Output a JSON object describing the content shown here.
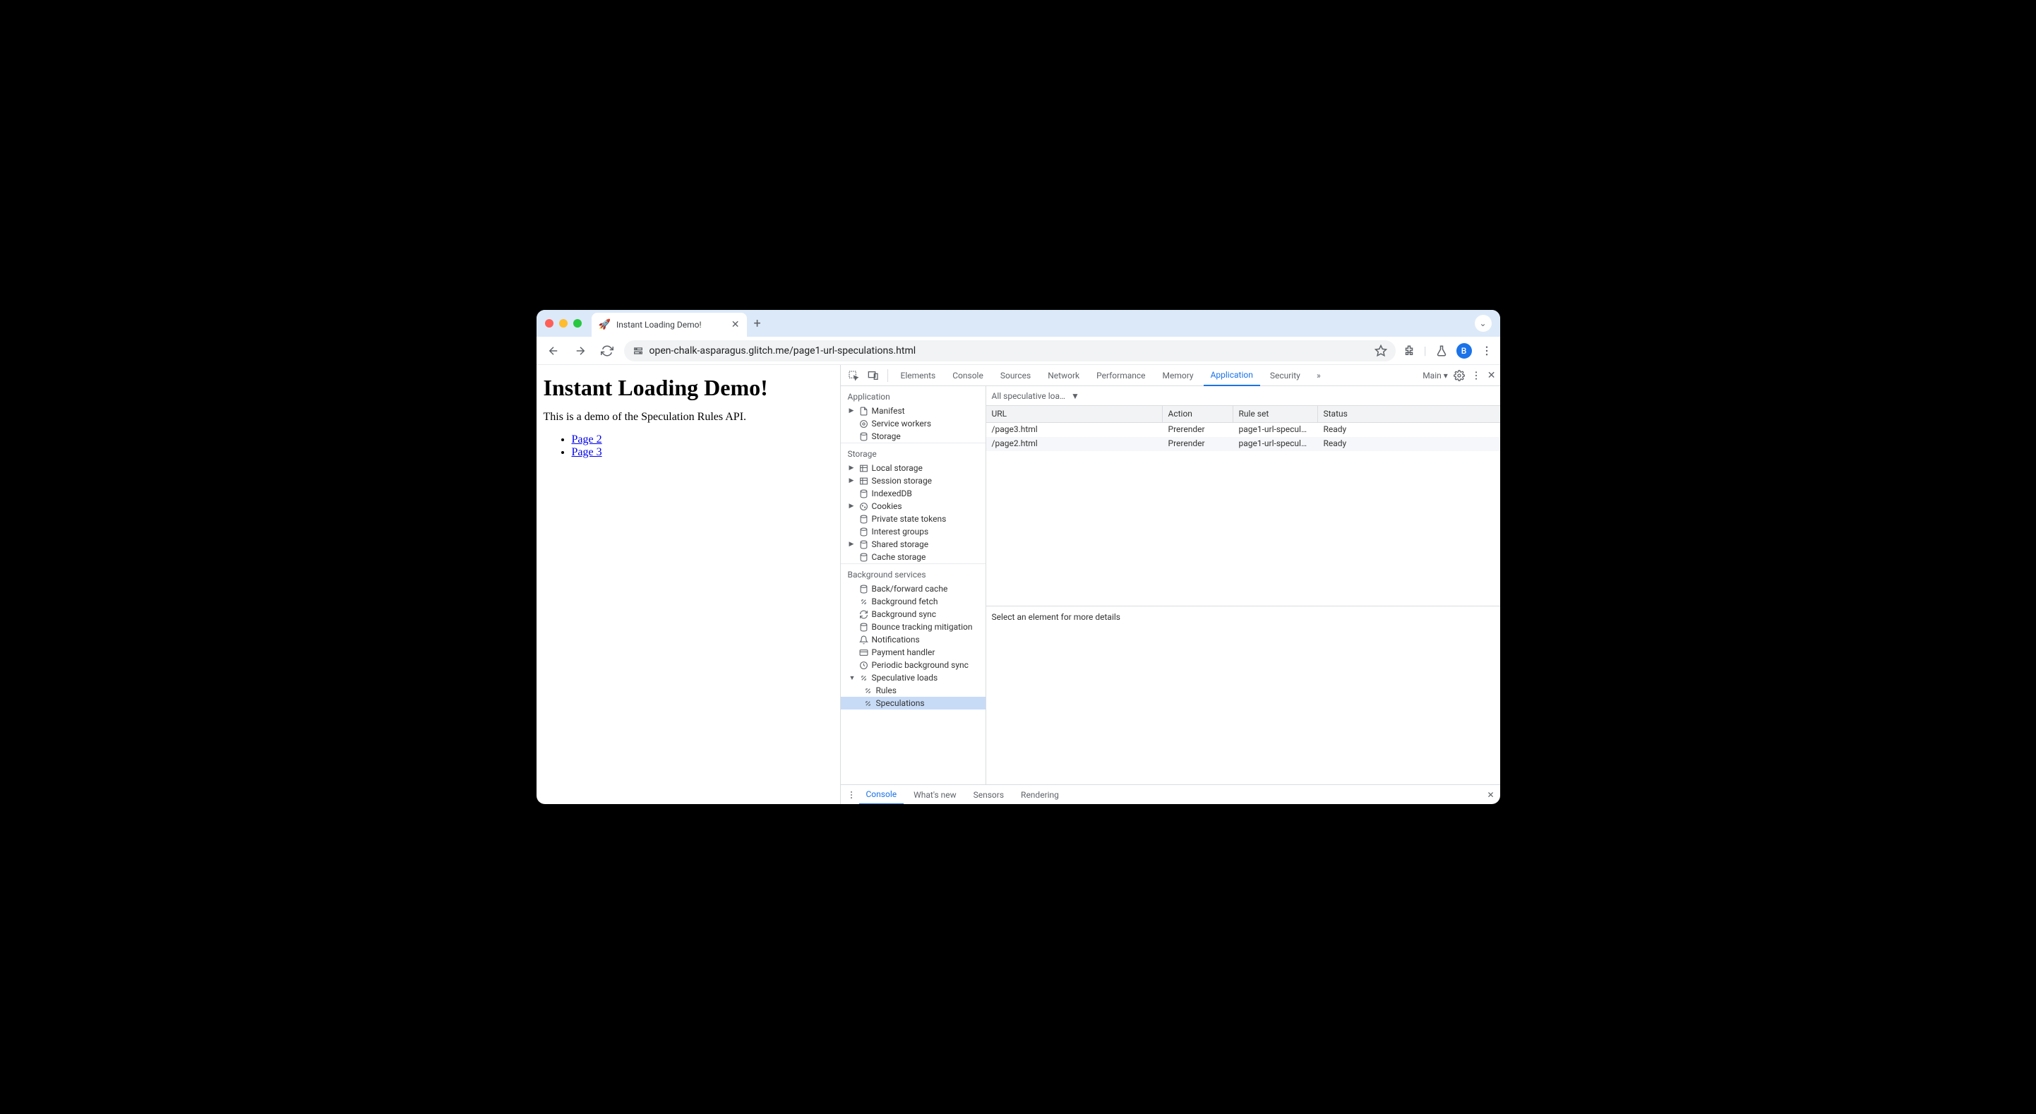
{
  "window": {
    "tab_favicon": "🚀",
    "tab_title": "Instant Loading Demo!",
    "url": "open-chalk-asparagus.glitch.me/page1-url-speculations.html",
    "profile_letter": "B"
  },
  "page": {
    "heading": "Instant Loading Demo!",
    "paragraph": "This is a demo of the Speculation Rules API.",
    "links": [
      "Page 2",
      "Page 3"
    ]
  },
  "devtools": {
    "tabs": [
      "Elements",
      "Console",
      "Sources",
      "Network",
      "Performance",
      "Memory",
      "Application",
      "Security"
    ],
    "active_tab": "Application",
    "target_label": "Main",
    "sidebar": {
      "application": {
        "header": "Application",
        "items": [
          "Manifest",
          "Service workers",
          "Storage"
        ]
      },
      "storage": {
        "header": "Storage",
        "items": [
          "Local storage",
          "Session storage",
          "IndexedDB",
          "Cookies",
          "Private state tokens",
          "Interest groups",
          "Shared storage",
          "Cache storage"
        ]
      },
      "background": {
        "header": "Background services",
        "items": [
          "Back/forward cache",
          "Background fetch",
          "Background sync",
          "Bounce tracking mitigation",
          "Notifications",
          "Payment handler",
          "Periodic background sync",
          "Speculative loads"
        ],
        "speculative_children": [
          "Rules",
          "Speculations"
        ],
        "active": "Speculations"
      }
    },
    "filter_label": "All speculative loa…",
    "table": {
      "headers": [
        "URL",
        "Action",
        "Rule set",
        "Status"
      ],
      "rows": [
        {
          "url": "/page3.html",
          "action": "Prerender",
          "ruleset": "page1-url-specul…",
          "status": "Ready"
        },
        {
          "url": "/page2.html",
          "action": "Prerender",
          "ruleset": "page1-url-specul…",
          "status": "Ready"
        }
      ]
    },
    "detail_placeholder": "Select an element for more details",
    "drawer_tabs": [
      "Console",
      "What's new",
      "Sensors",
      "Rendering"
    ],
    "drawer_active": "Console"
  }
}
